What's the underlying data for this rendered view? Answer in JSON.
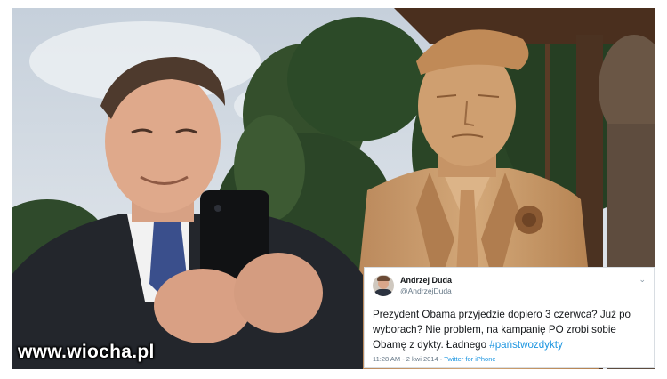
{
  "watermark": "www.wiocha.pl",
  "tweet": {
    "name": "Andrzej Duda",
    "handle": "@AndrzejDuda",
    "caret": "⌄",
    "text": "Prezydent Obama przyjedzie dopiero 3 czerwca? Już po wyborach? Nie problem, na kampanię PO zrobi sobie Obamę z dykty. Ładnego",
    "hashtag": "#państwozdykty",
    "timestamp": "11:28 AM - 2 kwi 2014",
    "separator": " · ",
    "source": "Twitter for iPhone"
  },
  "colors": {
    "link": "#1b95e0",
    "wood": "#c99a6c",
    "suit": "#25282e",
    "sky": "#d7dee6",
    "foliage": "#2f4a2b"
  }
}
